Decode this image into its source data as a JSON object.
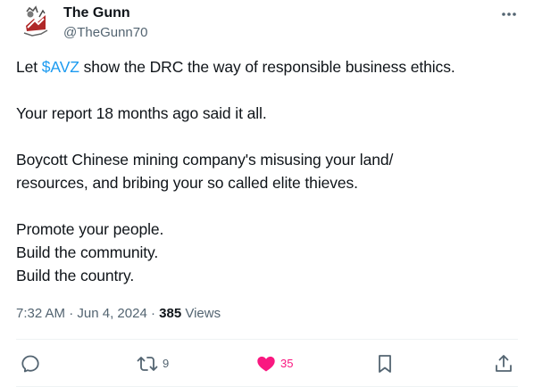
{
  "author": {
    "name": "The Gunn",
    "handle": "@TheGunn70"
  },
  "tweet": {
    "prefix": "Let ",
    "cashtag": "$AVZ",
    "line1_rest": " show the DRC the way of responsible business ethics.",
    "line2": "Your report 18 months ago said it all.",
    "line3": "Boycott Chinese mining company's misusing your land/",
    "line4": "resources, and bribing your so called elite thieves.",
    "line5": "Promote your people.",
    "line6": "Build the community.",
    "line7": "Build the country."
  },
  "meta": {
    "time": "7:32 AM",
    "separator": "·",
    "date": "Jun 4, 2024",
    "views_count": "385",
    "views_label": "Views"
  },
  "actions": {
    "reply": {
      "icon": "reply-icon",
      "count": ""
    },
    "repost": {
      "icon": "repost-icon",
      "count": "9"
    },
    "like": {
      "icon": "heart-filled-icon",
      "count": "35"
    },
    "bookmark": {
      "icon": "bookmark-icon",
      "count": ""
    },
    "share": {
      "icon": "share-icon",
      "count": ""
    }
  },
  "colors": {
    "text": "#0f1419",
    "secondary": "#536471",
    "link": "#1d9bf0",
    "like": "#f91880",
    "divider": "#eff3f4"
  }
}
